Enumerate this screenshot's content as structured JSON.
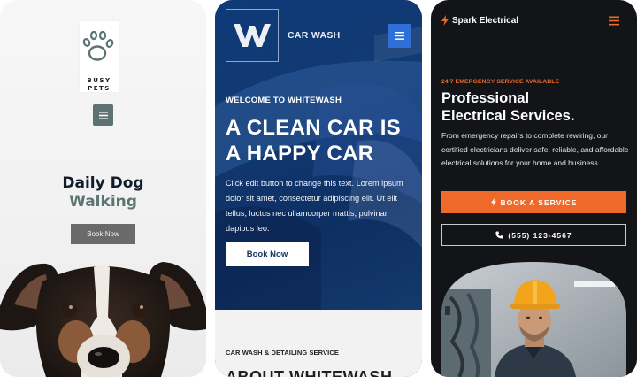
{
  "busy_pets": {
    "brand_line1": "BUSY",
    "brand_line2": "PETS",
    "heading_line1": "Daily Dog",
    "heading_line2": "Walking",
    "button_label": "Book Now",
    "menu_icon": "hamburger-icon",
    "colors": {
      "accent": "#5d7273",
      "heading_dark": "#0f1d2b",
      "button": "#6a6a6a"
    }
  },
  "whitewash": {
    "logo_letter": "W",
    "brand": "CAR WASH",
    "welcome": "WELCOME TO WHITEWASH",
    "title_line1": "A CLEAN CAR IS",
    "title_line2": "A HAPPY CAR",
    "body": "Click edit button to change this text. Lorem ipsum dolor sit amet, consectetur adipiscing elit. Ut elit tellus, luctus nec ullamcorper mattis, pulvinar dapibus leo.",
    "button_label": "Book Now",
    "section_label": "CAR WASH & DETAILING SERVICE",
    "section_title": "ABOUT WHITEWASH",
    "menu_icon": "hamburger-icon",
    "colors": {
      "background": "#0f3a78",
      "menu_button": "#2f6fd8"
    }
  },
  "spark": {
    "brand": "Spark Electrical",
    "emergency": "24/7 EMERGENCY SERVICE AVAILABLE",
    "title_line1": "Professional",
    "title_line2": "Electrical Services.",
    "body": "From emergency repairs to complete rewiring, our certified electricians deliver safe, reliable, and affordable electrical solutions for your home and business.",
    "cta_label": "BOOK A SERVICE",
    "phone_label": "(555) 123-4567",
    "menu_icon": "hamburger-icon",
    "colors": {
      "accent": "#ef6a2a",
      "background": "#121418"
    }
  }
}
